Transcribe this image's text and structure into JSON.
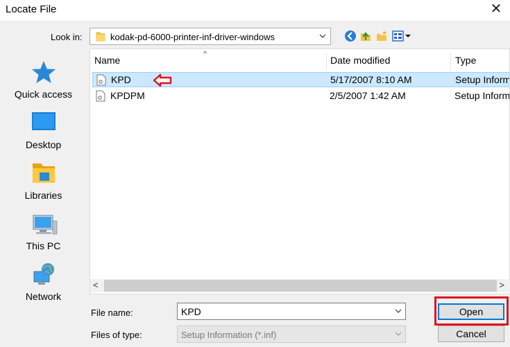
{
  "window": {
    "title": "Locate File"
  },
  "toolbar": {
    "look_in_label": "Look in:",
    "look_in_value": "kodak-pd-6000-printer-inf-driver-windows"
  },
  "places": [
    {
      "label": "Quick access",
      "icon": "star-icon"
    },
    {
      "label": "Desktop",
      "icon": "desktop-icon"
    },
    {
      "label": "Libraries",
      "icon": "libraries-icon"
    },
    {
      "label": "This PC",
      "icon": "computer-icon"
    },
    {
      "label": "Network",
      "icon": "network-icon"
    }
  ],
  "file_list": {
    "columns": [
      "Name",
      "Date modified",
      "Type"
    ],
    "rows": [
      {
        "name": "KPD",
        "date": "5/17/2007 8:10 AM",
        "type": "Setup Information",
        "selected": true
      },
      {
        "name": "KPDPM",
        "date": "2/5/2007 1:42 AM",
        "type": "Setup Information",
        "selected": false
      }
    ]
  },
  "form": {
    "file_name_label": "File name:",
    "file_name_value": "KPD",
    "file_type_label": "Files of type:",
    "file_type_value": "Setup Information (*.inf)"
  },
  "buttons": {
    "open": "Open",
    "cancel": "Cancel"
  },
  "colors": {
    "selection": "#cce8ff",
    "highlight_red": "#e0131d",
    "accent_blue": "#0078d7"
  }
}
